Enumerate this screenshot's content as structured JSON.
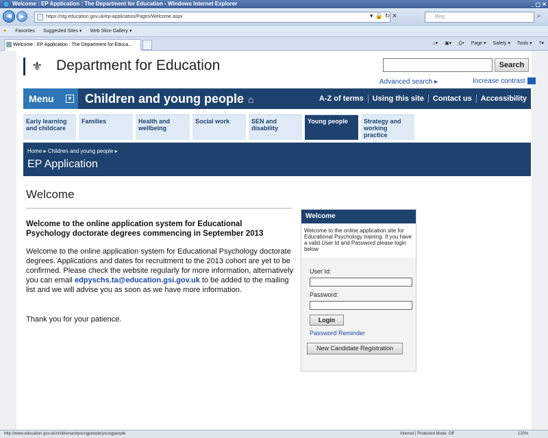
{
  "browser": {
    "window_title": "Welcome : EP Application : The Department for Education - Windows Internet Explorer",
    "url": "https://stg.education.gov.uk/ep-application/Pages/Welcome.aspx",
    "search_placeholder": "Bing",
    "favorites_label": "Favorites",
    "suggested_sites": "Suggested Sites ▾",
    "web_slice": "Web Slice Gallery ▾",
    "tab_title": "Welcome : EP Application : The Department for Educa...",
    "cmd_page": "Page ▾",
    "cmd_safety": "Safety ▾",
    "cmd_tools": "Tools ▾",
    "status_url": "http://www.education.gov.uk/childrenandyoungpeople/youngpeople",
    "status_zone": "Internet | Protected Mode: Off",
    "zoom": "120%"
  },
  "header": {
    "dept_title": "Department for Education",
    "search_button": "Search",
    "advanced_search": "Advanced search ▸",
    "increase_contrast": "Increase contrast"
  },
  "nav": {
    "menu_label": "Menu",
    "section_title": "Children and young people",
    "links": [
      "A-Z of terms",
      "Using this site",
      "Contact us",
      "Accessibility"
    ]
  },
  "subnav": [
    {
      "label": "Early learning and childcare"
    },
    {
      "label": "Families"
    },
    {
      "label": "Health and wellbeing"
    },
    {
      "label": "Social work"
    },
    {
      "label": "SEN and disability"
    },
    {
      "label": "Young people"
    },
    {
      "label": "Strategy and working practice"
    }
  ],
  "banner": {
    "crumb_home": "Home ▸",
    "crumb_section": "Children and young people ▸",
    "title": "EP Application"
  },
  "main": {
    "heading": "Welcome",
    "intro_bold": "Welcome to the online application system for Educational Psychology doctorate degrees commencing in September 2013",
    "para_before": "Welcome to the online application system for Educational Psychology doctorate degrees. Applications and dates for recruitment to the 2013 cohort are yet to be confirmed. Please check the website regularly for more information, alternatively you can email ",
    "email": "edpyschs.ta@education.gsi.gov.uk",
    "para_after": " to be added to the mailing list and we will advise you as soon as we have more information.",
    "thanks": "Thank you for your patience."
  },
  "login": {
    "header": "Welcome",
    "description": "Welcome to the online application site for Educational Psychology training. If you have a valid User Id and Password please login below",
    "user_label": "User Id:",
    "password_label": "Password:",
    "login_button": "Login",
    "reminder_link": "Password Reminder",
    "register_button": "New Candidate Registration"
  }
}
